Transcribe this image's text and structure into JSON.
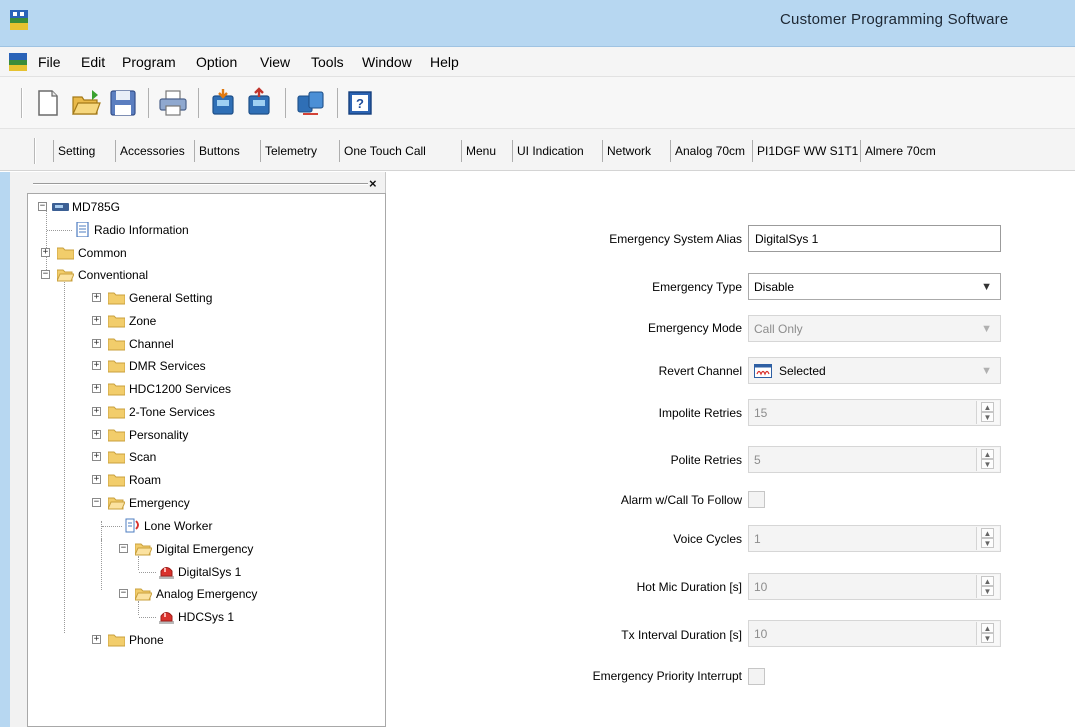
{
  "window": {
    "title": "Customer Programming Software"
  },
  "menu": [
    "File",
    "Edit",
    "Program",
    "Option",
    "View",
    "Tools",
    "Window",
    "Help"
  ],
  "toolbar": {
    "buttons": [
      "new-icon",
      "open-icon",
      "save-icon",
      "print-icon",
      "read-radio-icon",
      "write-radio-icon",
      "clone-icon",
      "help-icon"
    ]
  },
  "tabs": [
    "Setting",
    "Accessories",
    "Buttons",
    "Telemetry",
    "One Touch Call",
    "Menu",
    "UI Indication",
    "Network",
    "Analog 70cm",
    "PI1DGF WW S1T1",
    "Almere 70cm"
  ],
  "panel": {
    "close": "×"
  },
  "tree": {
    "root": "MD785G",
    "items": [
      "Radio Information",
      "Common",
      "Conventional",
      "General Setting",
      "Zone",
      "Channel",
      "DMR Services",
      "HDC1200 Services",
      "2-Tone Services",
      "Personality",
      "Scan",
      "Roam",
      "Emergency",
      "Lone Worker",
      "Digital Emergency",
      "DigitalSys 1",
      "Analog Emergency",
      "HDCSys 1",
      "Phone"
    ]
  },
  "form": {
    "alias_label": "Emergency System Alias",
    "alias_value": "DigitalSys 1",
    "type_label": "Emergency Type",
    "type_value": "Disable",
    "mode_label": "Emergency Mode",
    "mode_value": "Call Only",
    "revert_label": "Revert Channel",
    "revert_value": "Selected",
    "impolite_label": "Impolite Retries",
    "impolite_value": "15",
    "polite_label": "Polite Retries",
    "polite_value": "5",
    "alarm_label": "Alarm w/Call To Follow",
    "alarm_checked": false,
    "voice_label": "Voice Cycles",
    "voice_value": "1",
    "hotmic_label": "Hot Mic Duration [s]",
    "hotmic_value": "10",
    "txint_label": "Tx Interval Duration [s]",
    "txint_value": "10",
    "priority_label": "Emergency Priority Interrupt",
    "priority_checked": false
  },
  "colors": {
    "titlebar": "#b7d7f1",
    "folder": "#f2cd6b",
    "emergency": "#d9322d"
  }
}
